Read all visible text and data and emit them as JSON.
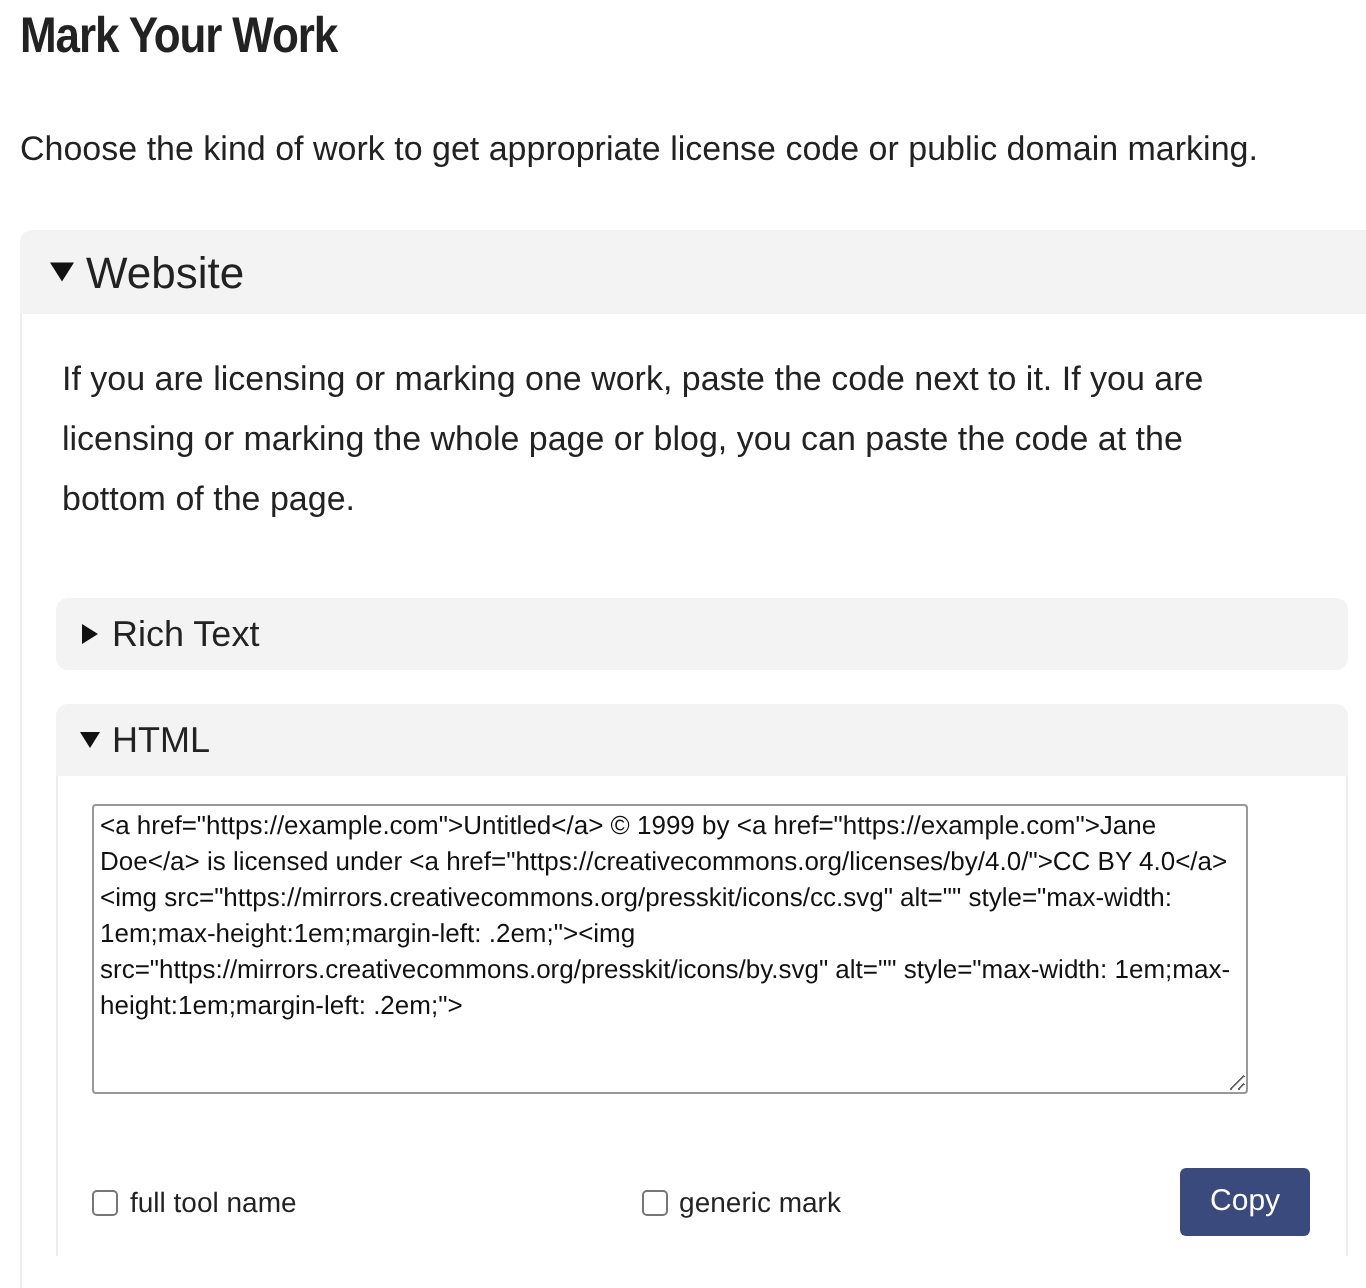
{
  "title": "Mark Your Work",
  "intro": "Choose the kind of work to get appropriate license code or public domain marking.",
  "sections": [
    {
      "label": "Website",
      "expanded": true,
      "description": "If you are licensing or marking one work, paste the code next to it. If you are licensing or marking the whole page or blog, you can paste the code at the bottom of the page.",
      "subsections": [
        {
          "label": "Rich Text",
          "expanded": false
        },
        {
          "label": "HTML",
          "expanded": true,
          "code": "<a href=\"https://example.com\">Untitled</a> © 1999 by <a href=\"https://example.com\">Jane Doe</a> is licensed under <a href=\"https://creativecommons.org/licenses/by/4.0/\">CC BY 4.0</a><img src=\"https://mirrors.creativecommons.org/presskit/icons/cc.svg\" alt=\"\" style=\"max-width: 1em;max-height:1em;margin-left: .2em;\"><img src=\"https://mirrors.creativecommons.org/presskit/icons/by.svg\" alt=\"\" style=\"max-width: 1em;max-height:1em;margin-left: .2em;\">",
          "options": [
            {
              "label": "full tool name",
              "checked": false
            },
            {
              "label": "generic mark",
              "checked": false
            }
          ],
          "button": "Copy"
        }
      ]
    }
  ]
}
